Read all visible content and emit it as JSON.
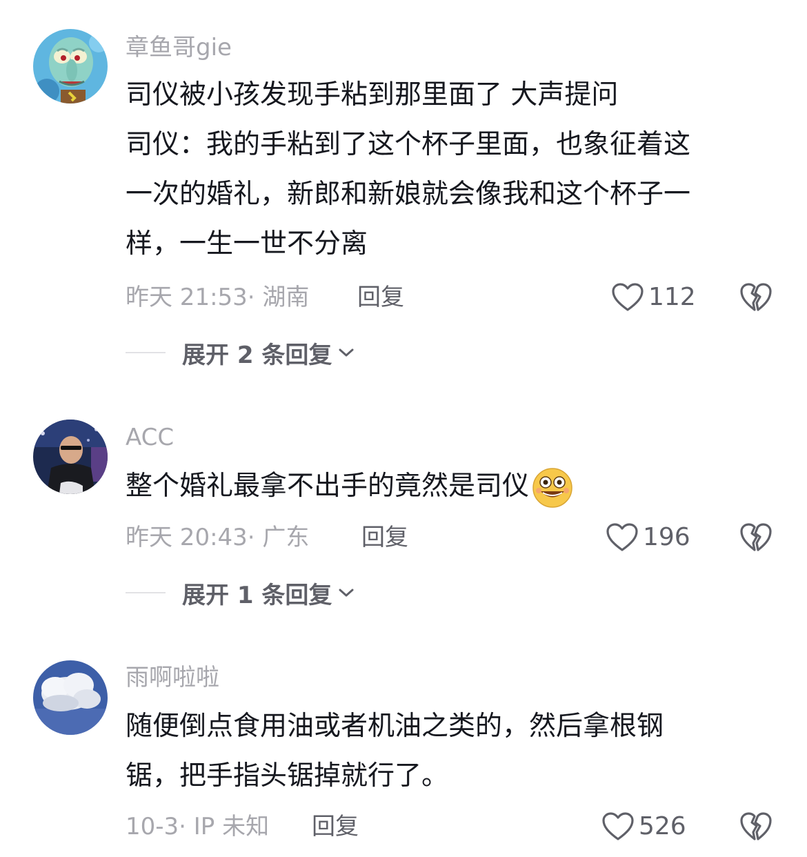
{
  "comments": [
    {
      "username": "章鱼哥gie",
      "lines": [
        "司仪被小孩发现手粘到那里面了 大声提问",
        "司仪：我的手粘到了这个杯子里面，也象征着这",
        "一次的婚礼，新郎和新娘就会像我和这个杯子一",
        "样，一生一世不分离"
      ],
      "time_location": "昨天 21:53· 湖南",
      "reply_label": "回复",
      "likes": "112",
      "expand_label": "展开 2 条回复",
      "avatar_icon": "squidward-avatar"
    },
    {
      "username": "ACC",
      "lines": [
        "整个婚礼最拿不出手的竟然是司仪"
      ],
      "emoji_icon": "grinning-emoji",
      "time_location": "昨天 20:43· 广东",
      "reply_label": "回复",
      "likes": "196",
      "expand_label": "展开 1 条回复",
      "avatar_icon": "bald-man-photo-avatar"
    },
    {
      "username": "雨啊啦啦",
      "lines": [
        "随便倒点食用油或者机油之类的，然后拿根钢",
        "锯，把手指头锯掉就行了。"
      ],
      "time_location": "10-3· IP 未知",
      "reply_label": "回复",
      "likes": "526",
      "avatar_icon": "cloud-sky-avatar"
    }
  ],
  "icons": {
    "like": "heart-outline-icon",
    "dislike": "broken-heart-icon",
    "expand": "chevron-down-icon"
  },
  "colors": {
    "username": "#a7a7ad",
    "content": "#16181f",
    "meta": "#a7a7ad",
    "action": "#5f6068"
  }
}
